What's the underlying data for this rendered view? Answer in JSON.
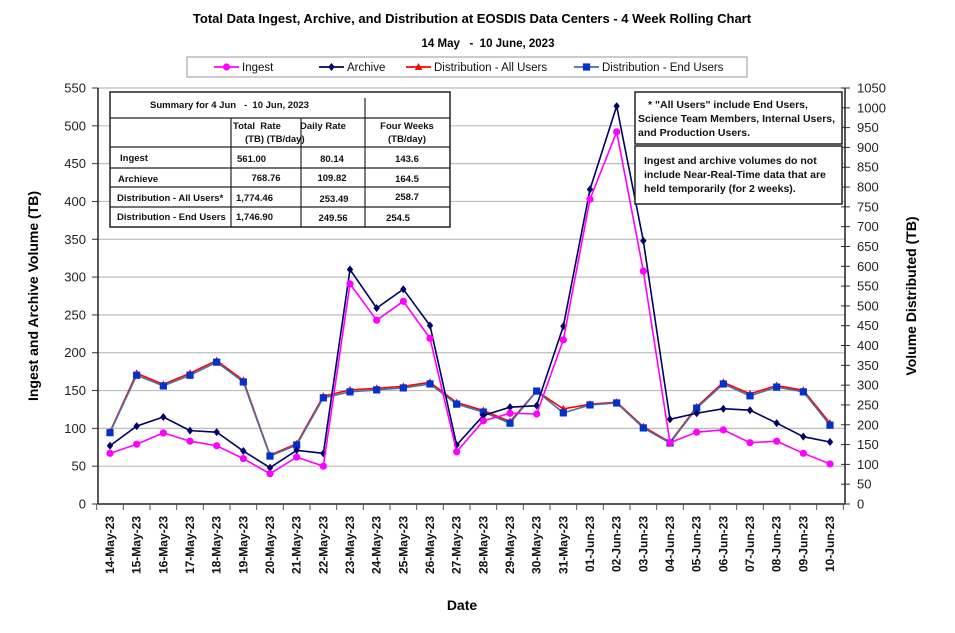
{
  "chart_data": {
    "type": "line",
    "title": "Total Data Ingest, Archive, and Distribution at EOSDIS Data Centers - 4 Week Rolling Chart",
    "subtitle": "14 May   -  10 June, 2023",
    "xlabel": "Date",
    "ylabel": "Ingest and Archive Volume (TB)",
    "y2label": "Volume Distributed (TB)",
    "ylim": [
      0,
      550
    ],
    "ystep": 50,
    "y2lim": [
      0,
      1050
    ],
    "y2step": 50,
    "grid": true,
    "legend_position": "top",
    "categories": [
      "14-May-23",
      "15-May-23",
      "16-May-23",
      "17-May-23",
      "18-May-23",
      "19-May-23",
      "20-May-23",
      "21-May-23",
      "22-May-23",
      "23-May-23",
      "24-May-23",
      "25-May-23",
      "26-May-23",
      "27-May-23",
      "28-May-23",
      "29-May-23",
      "30-May-23",
      "31-May-23",
      "01-Jun-23",
      "02-Jun-23",
      "03-Jun-23",
      "04-Jun-23",
      "05-Jun-23",
      "06-Jun-23",
      "07-Jun-23",
      "08-Jun-23",
      "09-Jun-23",
      "10-Jun-23"
    ],
    "series": [
      {
        "name": "Ingest",
        "axis": "left",
        "color": "#ff00ff",
        "marker": "circle",
        "values": [
          67,
          79,
          94,
          83,
          77,
          60,
          40,
          62,
          50,
          291,
          243,
          268,
          219,
          69,
          110,
          120,
          119,
          217,
          403,
          492,
          308,
          81,
          95,
          98,
          81,
          83,
          67,
          53
        ]
      },
      {
        "name": "Archive",
        "axis": "left",
        "color": "#000066",
        "marker": "diamond",
        "values": [
          77,
          103,
          115,
          97,
          95,
          70,
          48,
          71,
          67,
          310,
          259,
          284,
          236,
          78,
          117,
          128,
          130,
          235,
          416,
          526,
          348,
          112,
          120,
          126,
          124,
          107,
          89,
          82
        ]
      },
      {
        "name": "Distribution - All Users",
        "axis": "right",
        "color": "#ff0000",
        "marker": "triangle",
        "values": [
          182,
          330,
          302,
          330,
          362,
          312,
          123,
          152,
          272,
          288,
          292,
          297,
          307,
          256,
          236,
          208,
          285,
          240,
          252,
          257,
          195,
          156,
          245,
          307,
          278,
          299,
          287,
          204
        ]
      },
      {
        "name": "Distribution - End Users",
        "axis": "right",
        "color": "#0033cc",
        "marker": "square",
        "values": [
          180,
          325,
          298,
          325,
          358,
          308,
          121,
          149,
          268,
          283,
          288,
          293,
          303,
          252,
          232,
          204,
          285,
          230,
          250,
          255,
          192,
          154,
          242,
          303,
          273,
          295,
          283,
          199
        ]
      }
    ]
  },
  "summary_table": {
    "title": "Summary for 4 Jun   -  10 Jun, 2023",
    "headers": [
      "Total  Rate",
      "Daily Rate",
      "(TB) (TB/day)",
      "Four Weeks",
      "(TB/day)"
    ],
    "rows": [
      {
        "label": "Ingest",
        "total": "561.00",
        "daily": "80.14",
        "four_weeks": "143.6"
      },
      {
        "label": "Archieve",
        "total": "768.76",
        "daily": "109.82",
        "four_weeks": "164.5"
      },
      {
        "label": "Distribution - All Users*",
        "total": "1,774.46",
        "daily": "253.49",
        "four_weeks": "258.7"
      },
      {
        "label": "Distribution - End Users",
        "total": "1,746.90",
        "daily": "249.56",
        "four_weeks": "254.5"
      }
    ]
  },
  "notes": {
    "all_users": [
      "* \"All Users\" include End Users,",
      "Science Team Members, Internal Users,",
      "and Production Users."
    ],
    "nrt": [
      "Ingest and archive volumes do not",
      "include Near-Real-Time data that are",
      "held temporarily (for 2 weeks)."
    ]
  }
}
